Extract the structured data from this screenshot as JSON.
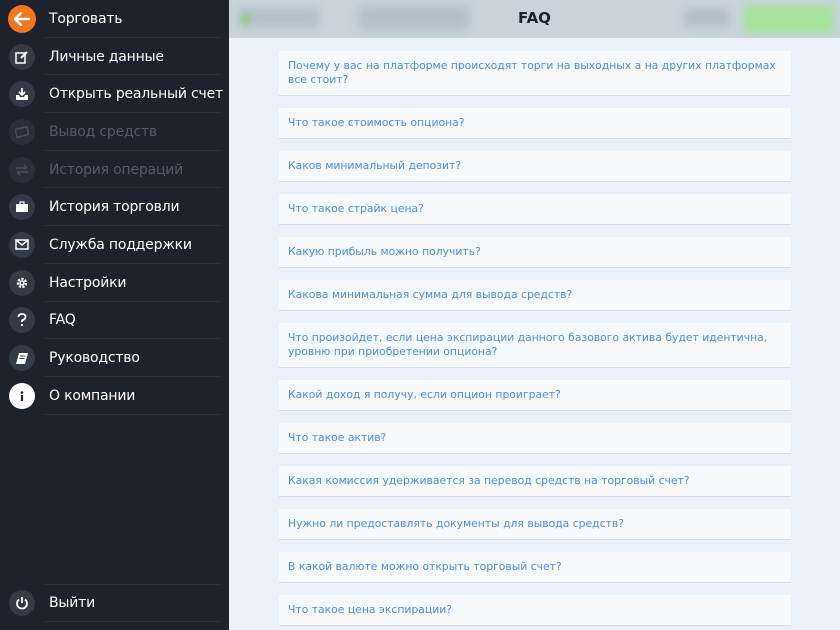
{
  "header": {
    "title": "FAQ"
  },
  "sidebar": {
    "items": [
      {
        "label": "Торговать",
        "icon": "arrow-left-icon",
        "disabled": false
      },
      {
        "label": "Личные данные",
        "icon": "edit-icon",
        "disabled": false
      },
      {
        "label": "Открыть реальный счет",
        "icon": "download-tray-icon",
        "disabled": false
      },
      {
        "label": "Вывод средств",
        "icon": "cash-icon",
        "disabled": true
      },
      {
        "label": "История операций",
        "icon": "exchange-icon",
        "disabled": true
      },
      {
        "label": "История торговли",
        "icon": "briefcase-icon",
        "disabled": false
      },
      {
        "label": "Служба поддержки",
        "icon": "envelope-icon",
        "disabled": false
      },
      {
        "label": "Настройки",
        "icon": "gear-icon",
        "disabled": false
      },
      {
        "label": "FAQ",
        "icon": "question-icon",
        "disabled": false
      },
      {
        "label": "Руководство",
        "icon": "book-icon",
        "disabled": false
      },
      {
        "label": "О компании",
        "icon": "info-icon",
        "disabled": false
      }
    ],
    "logout": {
      "label": "Выйти",
      "icon": "power-icon"
    }
  },
  "faq": {
    "questions": [
      "Почему у вас на платформе происходят торги на выходных а на других платформах все стоит?",
      "Что такое стоимость опциона?",
      "Каков минимальный депозит?",
      "Что такое страйк цена?",
      "Какую прибыль можно получить?",
      "Какова минимальная сумма для вывода средств?",
      "Что произойдет, если цена экспирации данного базового актива будет идентична, уровню при приобретении опциона?",
      "Какой доход я получу, если опцион проиграет?",
      "Что такое актив?",
      "Какая комиссия удерживается за перевод средств на торговый счет?",
      "Нужно ли предоставлять документы для вывода средств?",
      "В какой валюте можно открыть торговый счет?",
      "Что такое цена экспирации?"
    ]
  },
  "colors": {
    "sidebar_bg": "#1d222c",
    "accent_orange": "#f4761f",
    "link_blue": "#4a8fd6",
    "content_bg": "#eaf1f9"
  }
}
